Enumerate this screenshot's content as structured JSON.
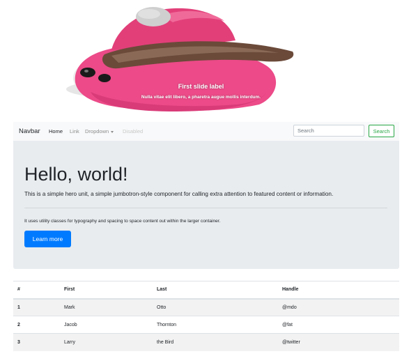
{
  "carousel": {
    "caption_title": "First slide label",
    "caption_text": "Nulla vitae elit libero, a pharetra augue mollis interdum.",
    "image": "pink-blob-with-santa-hat"
  },
  "navbar": {
    "brand": "Navbar",
    "links": [
      {
        "label": "Home",
        "state": "active"
      },
      {
        "label": "Link",
        "state": "normal"
      },
      {
        "label": "Dropdown",
        "state": "dropdown"
      },
      {
        "label": "Disabled",
        "state": "disabled"
      }
    ],
    "search_placeholder": "Search",
    "search_button": "Search"
  },
  "jumbotron": {
    "title": "Hello, world!",
    "lead": "This is a simple hero unit, a simple jumbotron-style component for calling extra attention to featured content or information.",
    "text": "It uses utility classes for typography and spacing to space content out within the larger container.",
    "button": "Learn more"
  },
  "table": {
    "headers": [
      "#",
      "First",
      "Last",
      "Handle"
    ],
    "rows": [
      [
        "1",
        "Mark",
        "Otto",
        "@mdo"
      ],
      [
        "2",
        "Jacob",
        "Thornton",
        "@fat"
      ],
      [
        "3",
        "Larry",
        "the Bird",
        "@twitter"
      ]
    ]
  },
  "colors": {
    "primary": "#007bff",
    "success": "#28a745",
    "jumbotron_bg": "#e9ecef",
    "navbar_bg": "#f8f9fa",
    "hat_pink": "#ee4f8b",
    "hat_fur": "#6b4a3a"
  }
}
